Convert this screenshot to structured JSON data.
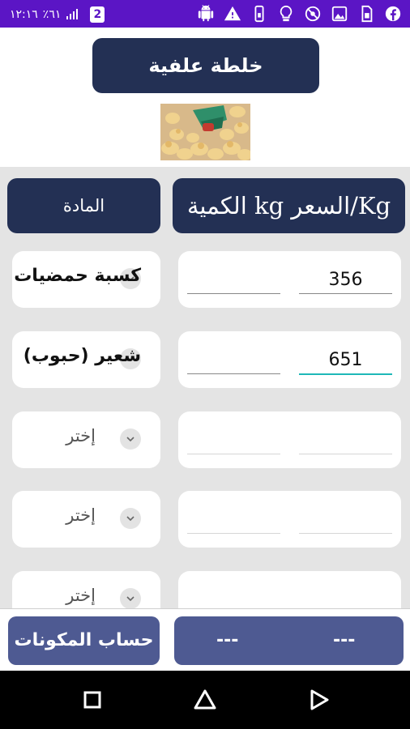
{
  "status_bar": {
    "time": "١٢:١٦",
    "network": "٪٦١",
    "notification_badge": "2",
    "background_color": "#5b15c5",
    "icons": [
      "facebook-icon",
      "sim-icon",
      "image-icon",
      "no-sync-icon",
      "lightbulb-icon",
      "phone-icon",
      "warning-icon",
      "android-icon"
    ]
  },
  "header": {
    "title": "خلطة علفية",
    "primary_color": "#233054"
  },
  "table": {
    "headers": {
      "quantity_price": "الكمية kg السعر/Kg",
      "material": "المادة"
    },
    "rows": [
      {
        "quantity": "356",
        "price": "",
        "material": "كسبة حمضيات",
        "active": false
      },
      {
        "quantity": "651",
        "price": "",
        "material": "شعير (حبوب)",
        "active": true
      },
      {
        "quantity": "",
        "price": "",
        "material": "إختر",
        "active": false
      },
      {
        "quantity": "",
        "price": "",
        "material": "إختر",
        "active": false
      },
      {
        "quantity": "",
        "price": "",
        "material": "إختر",
        "active": false
      }
    ]
  },
  "footer": {
    "calculate_label": "حساب المكونات",
    "result_1": "---",
    "result_2": "---",
    "button_color": "#4e5a92"
  },
  "nav": {
    "icons": [
      "recents-icon",
      "home-icon",
      "back-icon"
    ]
  }
}
